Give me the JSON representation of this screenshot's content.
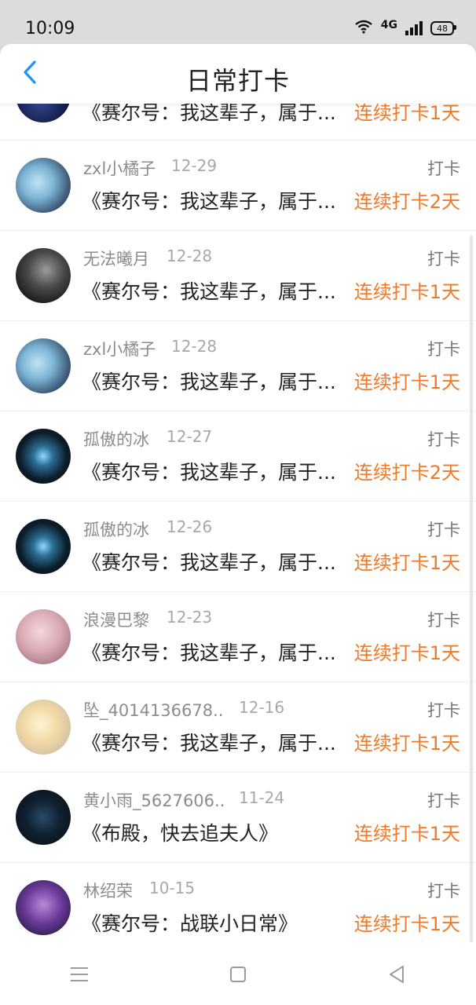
{
  "status_bar": {
    "time": "10:09",
    "battery": "48",
    "network": "4G"
  },
  "header": {
    "title": "日常打卡",
    "back_icon": "chevron-left-icon"
  },
  "colors": {
    "accent": "#f07a2a",
    "back": "#1e90ff"
  },
  "items": [
    {
      "user": "",
      "date": "",
      "tag": "",
      "book": "《赛尔号：我这辈子，属于...",
      "streak": "连续打卡1天"
    },
    {
      "user": "zxl小橘子",
      "date": "12-29",
      "tag": "打卡",
      "book": "《赛尔号：我这辈子，属于...",
      "streak": "连续打卡2天"
    },
    {
      "user": "无法曦月",
      "date": "12-28",
      "tag": "打卡",
      "book": "《赛尔号：我这辈子，属于...",
      "streak": "连续打卡1天"
    },
    {
      "user": "zxl小橘子",
      "date": "12-28",
      "tag": "打卡",
      "book": "《赛尔号：我这辈子，属于...",
      "streak": "连续打卡1天"
    },
    {
      "user": "孤傲的冰",
      "date": "12-27",
      "tag": "打卡",
      "book": "《赛尔号：我这辈子，属于...",
      "streak": "连续打卡2天"
    },
    {
      "user": "孤傲的冰",
      "date": "12-26",
      "tag": "打卡",
      "book": "《赛尔号：我这辈子，属于...",
      "streak": "连续打卡1天"
    },
    {
      "user": "浪漫巴黎",
      "date": "12-23",
      "tag": "打卡",
      "book": "《赛尔号：我这辈子，属于...",
      "streak": "连续打卡1天"
    },
    {
      "user": "坠_4014136678...",
      "date": "12-16",
      "tag": "打卡",
      "book": "《赛尔号：我这辈子，属于...",
      "streak": "连续打卡1天"
    },
    {
      "user": "黄小雨_5627606...",
      "date": "11-24",
      "tag": "打卡",
      "book": "《布殿，快去追夫人》",
      "streak": "连续打卡1天"
    },
    {
      "user": "林绍荣",
      "date": "10-15",
      "tag": "打卡",
      "book": "《赛尔号：战联小日常》",
      "streak": "连续打卡1天"
    }
  ],
  "navbar": {
    "menu_icon": "menu-icon",
    "home_icon": "square-home-icon",
    "back_icon": "triangle-back-icon"
  }
}
